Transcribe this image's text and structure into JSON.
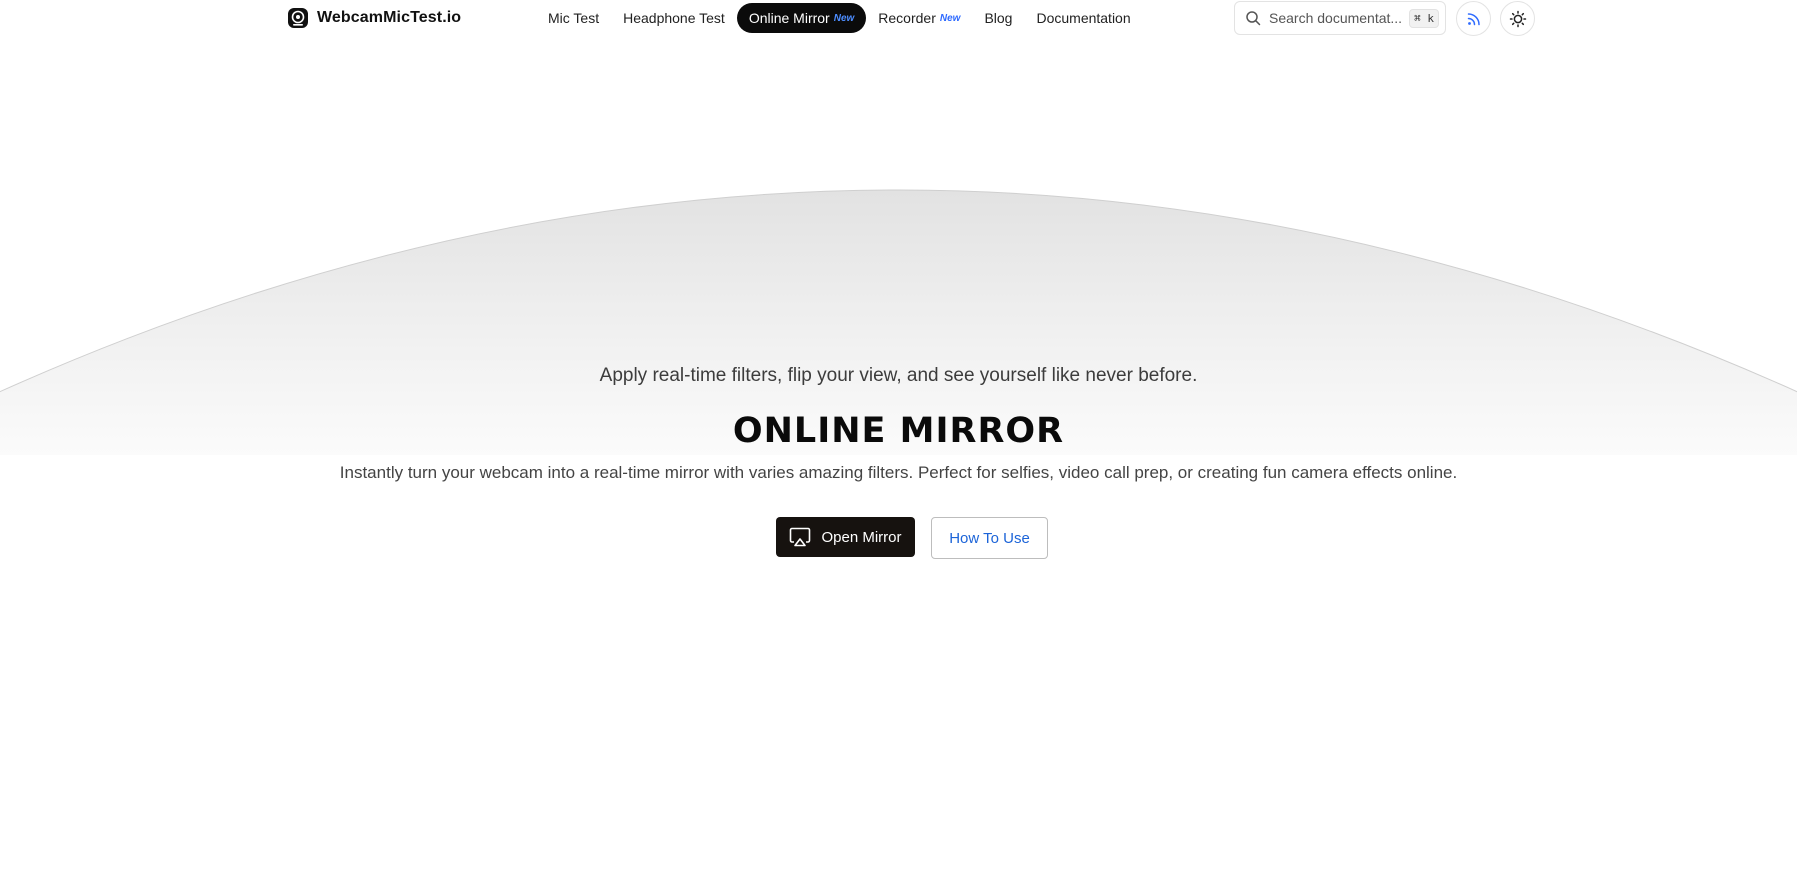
{
  "header": {
    "logo_text": "WebcamMicTest.io",
    "nav": [
      {
        "label": "Mic Test",
        "badge": "",
        "active": false
      },
      {
        "label": "Headphone Test",
        "badge": "",
        "active": false
      },
      {
        "label": "Online Mirror",
        "badge": "New",
        "active": true
      },
      {
        "label": "Recorder",
        "badge": "New",
        "active": false
      },
      {
        "label": "Blog",
        "badge": "",
        "active": false
      },
      {
        "label": "Documentation",
        "badge": "",
        "active": false
      }
    ],
    "search": {
      "placeholder": "Search documentat...",
      "shortcut": "⌘ k"
    },
    "icons": {
      "rss": "rss-icon",
      "theme": "sun-icon",
      "search": "search-icon"
    }
  },
  "hero": {
    "tagline": "Apply real-time filters, flip your view, and see yourself like never before.",
    "title": "ONLINE MIRROR",
    "description": "Instantly turn your webcam into a real-time mirror with varies amazing filters. Perfect for selfies, video call prep, or creating fun camera effects online.",
    "primary_button": "Open Mirror",
    "secondary_button": "How To Use"
  },
  "colors": {
    "accent": "#2f6bff",
    "dark": "#0b0b0b",
    "link": "#1c64d8"
  }
}
